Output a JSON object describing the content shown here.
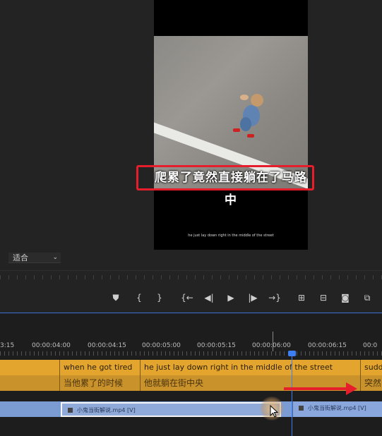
{
  "monitor": {
    "subtitle_cn": "爬累了竟然直接躺在了马路中",
    "subtitle_en": "he just lay down right in the middle of the street",
    "fit_dropdown": "适合"
  },
  "transport": {
    "icons": [
      "marker-icon",
      "mark-in-icon",
      "mark-out-icon",
      "go-to-in-icon",
      "step-back-icon",
      "play-icon",
      "step-forward-icon",
      "go-to-out-icon",
      "lift-icon",
      "extract-icon",
      "camera-icon",
      "compare-icon"
    ]
  },
  "timeline": {
    "timecodes": [
      "3:15",
      "00:00:04:00",
      "00:00:04:15",
      "00:00:05:00",
      "00:00:05:15",
      "00:00:06:00",
      "00:00:06:15",
      "00:0"
    ],
    "captions_en": [
      "when he got tired",
      "he just lay down right in the middle of the street",
      "sudd"
    ],
    "captions_cn": [
      "当他累了的时候",
      "他就躺在街中央",
      "突然"
    ],
    "clips": [
      "小鬼当街解说.mp4 [V]",
      "小鬼当街解说.mp4 [V]"
    ]
  },
  "colors": {
    "highlight": "#e61e2b",
    "caption_track": "#e3a52e",
    "video_track": "#7b9bd3",
    "playhead": "#3d7ef5"
  }
}
